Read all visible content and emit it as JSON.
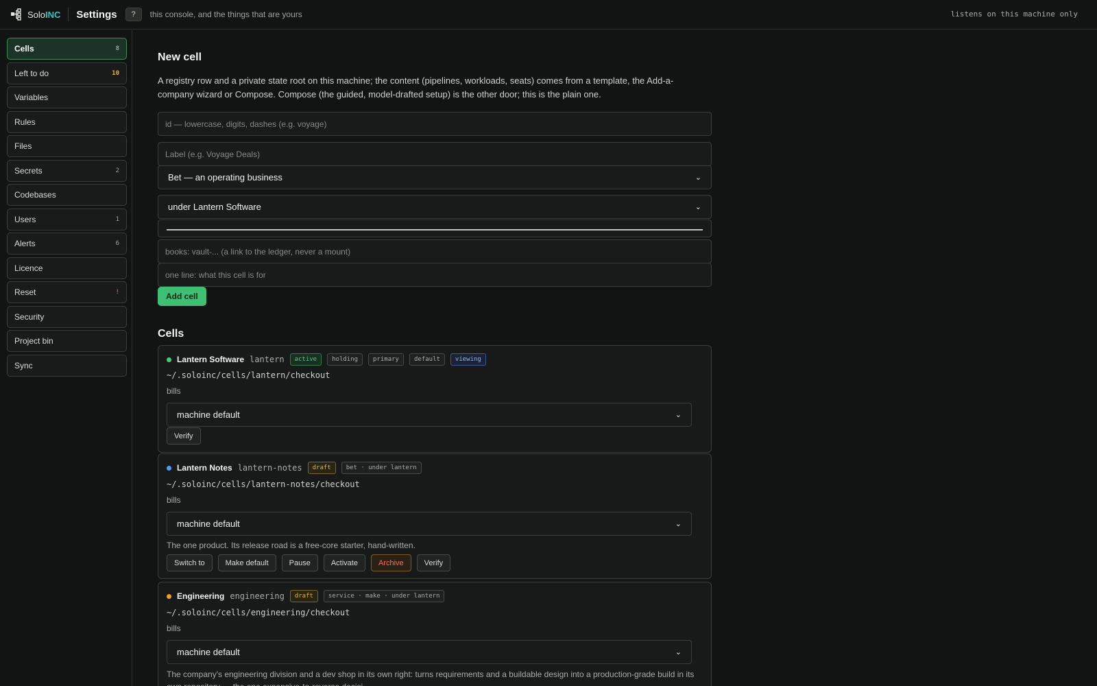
{
  "header": {
    "brand_main": "Solo",
    "brand_accent": "INC",
    "title": "Settings",
    "help_label": "?",
    "tagline": "this console, and the things that are yours",
    "listen_note": "listens on this machine only"
  },
  "sidebar": {
    "items": [
      {
        "label": "Cells",
        "count": "8"
      },
      {
        "label": "Left to do",
        "count": "10"
      },
      {
        "label": "Variables",
        "count": ""
      },
      {
        "label": "Rules",
        "count": ""
      },
      {
        "label": "Files",
        "count": ""
      },
      {
        "label": "Secrets",
        "count": "2"
      },
      {
        "label": "Codebases",
        "count": ""
      },
      {
        "label": "Users",
        "count": "1"
      },
      {
        "label": "Alerts",
        "count": "6"
      },
      {
        "label": "Licence",
        "count": ""
      },
      {
        "label": "Reset",
        "count": "!"
      },
      {
        "label": "Security",
        "count": ""
      },
      {
        "label": "Project bin",
        "count": ""
      },
      {
        "label": "Sync",
        "count": ""
      }
    ]
  },
  "new_cell": {
    "heading": "New cell",
    "description": "A registry row and a private state root on this machine; the content (pipelines, workloads, seats) comes from a template, the Add-a-company wizard or Compose. Compose (the guided, model-drafted setup) is the other door; this is the plain one.",
    "id_placeholder": "id — lowercase, digits, dashes (e.g. voyage)",
    "label_placeholder": "Label (e.g. Voyage Deals)",
    "kind_selected": "Bet — an operating business",
    "parent_selected": "under Lantern Software",
    "books_placeholder": "books: vault-... (a link to the ledger, never a mount)",
    "purpose_placeholder": "one line: what this cell is for",
    "add_button": "Add cell"
  },
  "cells_section": {
    "heading": "Cells",
    "cells": [
      {
        "name": "Lantern Software",
        "id": "lantern",
        "dot_color": "#3fd17a",
        "badges": [
          "active",
          "holding",
          "primary",
          "default",
          "viewing"
        ],
        "path": "~/.soloinc/cells/lantern/checkout",
        "bills_label": "bills",
        "bills_selected": "machine default",
        "note": "",
        "actions": [
          "Verify"
        ]
      },
      {
        "name": "Lantern Notes",
        "id": "lantern-notes",
        "dot_color": "#4a9eff",
        "badges": [
          "draft",
          "bet · under lantern"
        ],
        "path": "~/.soloinc/cells/lantern-notes/checkout",
        "bills_label": "bills",
        "bills_selected": "machine default",
        "note": "The one product. Its release road is a free-core starter, hand-written.",
        "actions": [
          "Switch to",
          "Make default",
          "Pause",
          "Activate",
          "Archive",
          "Verify"
        ]
      },
      {
        "name": "Engineering",
        "id": "engineering",
        "dot_color": "#f0a020",
        "badges": [
          "draft",
          "service · make · under lantern"
        ],
        "path": "~/.soloinc/cells/engineering/checkout",
        "bills_label": "bills",
        "bills_selected": "machine default",
        "note": "The company's engineering division and a dev shop in its own right: turns requirements and a buildable design into a production-grade build in its own repository — the one expensive-to-reverse decisi",
        "actions": []
      }
    ]
  },
  "icons": {
    "logo": "network-node-icon",
    "select_chevron": "chevron-down-icon"
  }
}
